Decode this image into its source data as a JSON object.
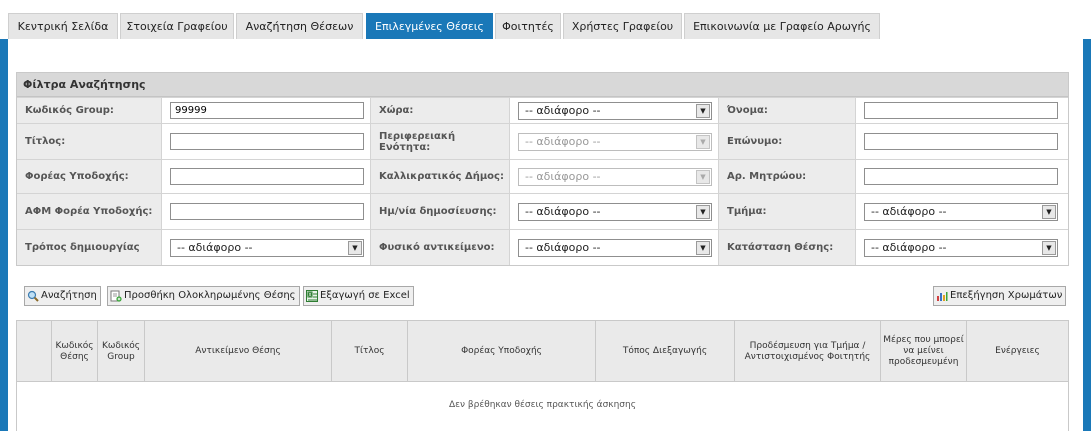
{
  "nav": {
    "tabs": [
      {
        "label": "Κεντρική Σελίδα"
      },
      {
        "label": "Στοιχεία Γραφείου"
      },
      {
        "label": "Αναζήτηση Θέσεων"
      },
      {
        "label": "Επιλεγμένες Θέσεις",
        "active": true
      },
      {
        "label": "Φοιτητές"
      },
      {
        "label": "Χρήστες Γραφείου"
      },
      {
        "label": "Επικοινωνία με Γραφείο Αρωγής"
      }
    ]
  },
  "filters": {
    "title": "Φίλτρα Αναζήτησης",
    "group_code": {
      "label": "Κωδικός Group:",
      "value": "99999"
    },
    "country": {
      "label": "Χώρα:",
      "value": "-- αδιάφορο --"
    },
    "first_name": {
      "label": "Όνομα:",
      "value": ""
    },
    "title_field": {
      "label": "Τίτλος:",
      "value": ""
    },
    "region": {
      "label": "Περιφερειακή Ενότητα:",
      "value": "-- αδιάφορο --",
      "disabled": true
    },
    "last_name": {
      "label": "Επώνυμο:",
      "value": ""
    },
    "host": {
      "label": "Φορέας Υποδοχής:",
      "value": ""
    },
    "municipality": {
      "label": "Καλλικρατικός Δήμος:",
      "value": "-- αδιάφορο --",
      "disabled": true
    },
    "registry_no": {
      "label": "Αρ. Μητρώου:",
      "value": ""
    },
    "host_afm": {
      "label": "ΑΦΜ Φορέα Υποδοχής:",
      "value": ""
    },
    "publish_date": {
      "label": "Ημ/νία δημοσίευσης:",
      "value": "-- αδιάφορο --"
    },
    "department": {
      "label": "Τμήμα:",
      "value": "-- αδιάφορο --"
    },
    "creation_method": {
      "label": "Τρόπος δημιουργίας",
      "value": "-- αδιάφορο --"
    },
    "physical_object": {
      "label": "Φυσικό αντικείμενο:",
      "value": "-- αδιάφορο --"
    },
    "position_status": {
      "label": "Κατάσταση Θέσης:",
      "value": "-- αδιάφορο --"
    }
  },
  "actions": {
    "search": "Αναζήτηση",
    "add_completed": "Προσθήκη Ολοκληρωμένης Θέσης",
    "export_excel": "Εξαγωγή σε Excel",
    "color_legend": "Επεξήγηση Χρωμάτων"
  },
  "grid": {
    "columns": [
      "",
      "Κωδικός Θέσης",
      "Κωδικός Group",
      "Αντικείμενο Θέσης",
      "Τίτλος",
      "Φορέας Υποδοχής",
      "Τόπος Διεξαγωγής",
      "Προδέσμευση για Τμήμα / Αντιστοιχισμένος Φοιτητής",
      "Μέρες που μπορεί να μείνει προδεσμευμένη",
      "Ενέργειες"
    ],
    "empty_message": "Δεν βρέθηκαν θέσεις πρακτικής άσκησης"
  },
  "colors": {
    "accent": "#1a78b8",
    "header_bg": "#d8d8d8",
    "label_bg": "#ececec"
  }
}
